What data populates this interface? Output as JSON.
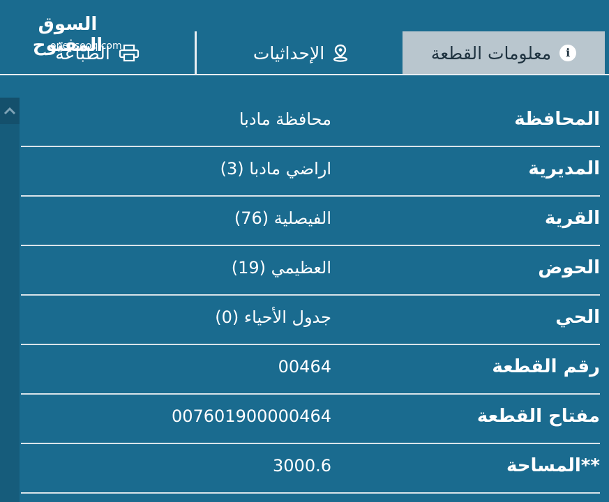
{
  "logo": {
    "arabic": "السوق المفتوح",
    "english": "opensooq.com"
  },
  "tabs": [
    {
      "label": "معلومات القطعة",
      "icon": "info-icon",
      "active": true
    },
    {
      "label": "الإحداثيات",
      "icon": "location-pin-icon",
      "active": false
    },
    {
      "label": "الطباعة",
      "icon": "printer-icon",
      "active": false
    }
  ],
  "rows": [
    {
      "label": "المحافظة",
      "value": "محافظة مادبا"
    },
    {
      "label": "المديرية",
      "value": "اراضي مادبا (3)"
    },
    {
      "label": "القرية",
      "value": "الفيصلية (76)"
    },
    {
      "label": "الحوض",
      "value": "العظيمي (19)"
    },
    {
      "label": "الحي",
      "value": "جدول الأحياء (0)"
    },
    {
      "label": "رقم القطعة",
      "value": "00464"
    },
    {
      "label": "مفتاح القطعة",
      "value": "007601900000464"
    },
    {
      "label": "**المساحة",
      "value": "3000.6"
    }
  ],
  "colors": {
    "background": "#1a6b8f",
    "active_tab": "#b9c6ce",
    "divider": "#d9e4ea"
  }
}
